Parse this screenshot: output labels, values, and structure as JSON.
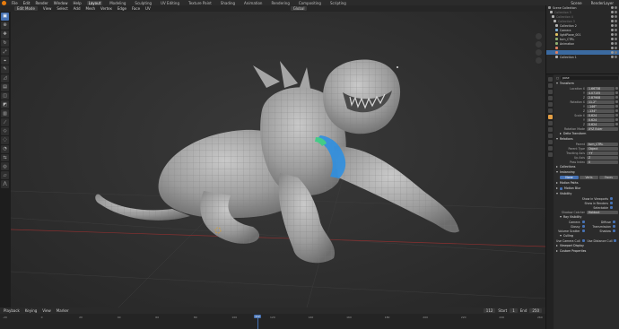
{
  "topbar": {
    "menus": [
      "File",
      "Edit",
      "Render",
      "Window",
      "Help"
    ],
    "workspaces": [
      "Layout",
      "Modeling",
      "Sculpting",
      "UV Editing",
      "Texture Paint",
      "Shading",
      "Animation",
      "Rendering",
      "Compositing",
      "Scripting"
    ],
    "active_workspace": "Layout",
    "scene": "Scene",
    "view_layer": "RenderLayer"
  },
  "viewport_header": {
    "mode": "Edit Mode",
    "menus": [
      "View",
      "Select",
      "Add",
      "Mesh",
      "Vertex",
      "Edge",
      "Face",
      "UV"
    ],
    "transform_orientation": "Global"
  },
  "toolbar": {
    "tools": [
      "select-box-icon",
      "cursor-icon",
      "move-icon",
      "rotate-icon",
      "scale-icon",
      "transform-icon",
      "annotate-icon",
      "measure-icon",
      "extrude-icon",
      "inset-icon",
      "bevel-icon",
      "loopcut-icon",
      "knife-icon",
      "polybuild-icon",
      "spin-icon",
      "smooth-icon",
      "slide-icon",
      "shrink-icon",
      "shear-icon",
      "rip-icon"
    ]
  },
  "timeline": {
    "menus": [
      "Playback",
      "Keying",
      "View",
      "Marker"
    ],
    "current_frame": "112",
    "start_label": "Start",
    "start": "1",
    "end_label": "End",
    "end": "250",
    "ticks": [
      "-20",
      "0",
      "20",
      "40",
      "60",
      "80",
      "100",
      "120",
      "140",
      "160",
      "180",
      "200",
      "220",
      "240",
      "260"
    ]
  },
  "outliner": {
    "rows": [
      {
        "label": "Scene Collection",
        "selected": false,
        "dim": false
      },
      {
        "label": "Collection 5",
        "selected": false,
        "dim": true
      },
      {
        "label": "Collection 4",
        "selected": false,
        "dim": true
      },
      {
        "label": "Collection 3",
        "selected": false,
        "dim": true
      },
      {
        "label": "Collection 2",
        "selected": false,
        "dim": false
      },
      {
        "label": "Camera",
        "selected": false,
        "dim": false
      },
      {
        "label": "lightPlane_001",
        "selected": false,
        "dim": false
      },
      {
        "label": "turn_CTRL",
        "selected": false,
        "dim": false
      },
      {
        "label": "Animation",
        "selected": false,
        "dim": false
      },
      {
        "label": "",
        "selected": false,
        "dim": false
      },
      {
        "label": "",
        "selected": true,
        "dim": false
      },
      {
        "label": "Collection 1",
        "selected": false,
        "dim": false
      }
    ]
  },
  "properties": {
    "object_name": "pose",
    "transform_section": "Transform",
    "transform_rows": [
      {
        "label": "Location X",
        "value": "1.66738"
      },
      {
        "label": "Y",
        "value": "4.07155"
      },
      {
        "label": "Z",
        "value": "2.87908"
      },
      {
        "label": "Rotation X",
        "value": "11.2°"
      },
      {
        "label": "Y",
        "value": "-146°"
      },
      {
        "label": "Z",
        "value": "-134°"
      },
      {
        "label": "Scale X",
        "value": "0.624"
      },
      {
        "label": "Y",
        "value": "0.624"
      },
      {
        "label": "Z",
        "value": "0.624"
      },
      {
        "label": "Rotation Mode",
        "value": "XYZ Euler"
      }
    ],
    "delta_section": "Delta Transform",
    "relations_section": "Relations",
    "relations_rows": [
      {
        "label": "Parent",
        "value": "turn_CTRL"
      },
      {
        "label": "Parent Type",
        "value": "Object"
      },
      {
        "label": "Tracking Axis",
        "value": "+Y"
      },
      {
        "label": "Up Axis",
        "value": "Z"
      },
      {
        "label": "Pass Index",
        "value": "0"
      }
    ],
    "collections_section": "Collections",
    "instancing_section": "Instancing",
    "instancing_options": [
      "None",
      "Verts",
      "Faces"
    ],
    "instancing_active": "None",
    "motion_paths_section": "Motion Paths",
    "motion_blur_label": "Motion Blur",
    "visibility_section": "Visibility",
    "visibility_checks": [
      "Show in Viewports",
      "Show in Renders",
      "Selectable"
    ],
    "shadow_catcher_label": "Shadow Catcher",
    "shadow_catcher_value": "Holdout",
    "ray_visibility_section": "Ray Visibility",
    "ray_visibility": [
      [
        "Camera",
        "Diffuse"
      ],
      [
        "Glossy",
        "Transmission"
      ],
      [
        "Volume Scatter",
        "Shadow"
      ]
    ],
    "culling_section": "Culling",
    "culling_checks": [
      "Use Camera Cull",
      "Use Distance Cull"
    ],
    "viewport_display_section": "Viewport Display",
    "custom_props_section": "Custom Properties"
  }
}
